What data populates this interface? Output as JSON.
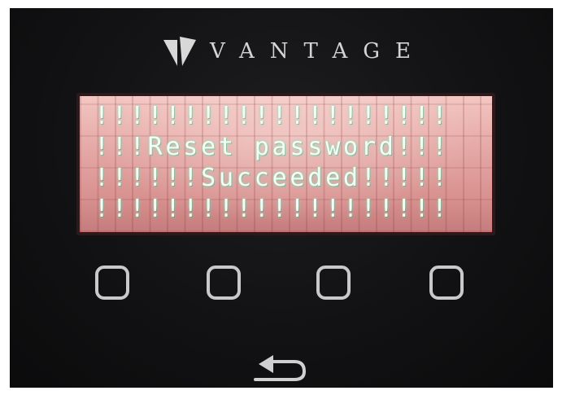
{
  "brand": {
    "name": "VANTAGE",
    "logo_icon": "vantage-v-logo-icon"
  },
  "display": {
    "lines": [
      "!!!!!!!!!!!!!!!!!!!!",
      "!!!Reset password!!!",
      "!!!!!!Succeeded!!!!!",
      "!!!!!!!!!!!!!!!!!!!!"
    ],
    "backlight_color": "#e4a5a3",
    "text_color": "#eefdf5"
  },
  "controls": {
    "softkeys": [
      "square-key-icon",
      "square-key-icon",
      "square-key-icon",
      "square-key-icon"
    ],
    "back_icon": "return-arrow-icon"
  }
}
